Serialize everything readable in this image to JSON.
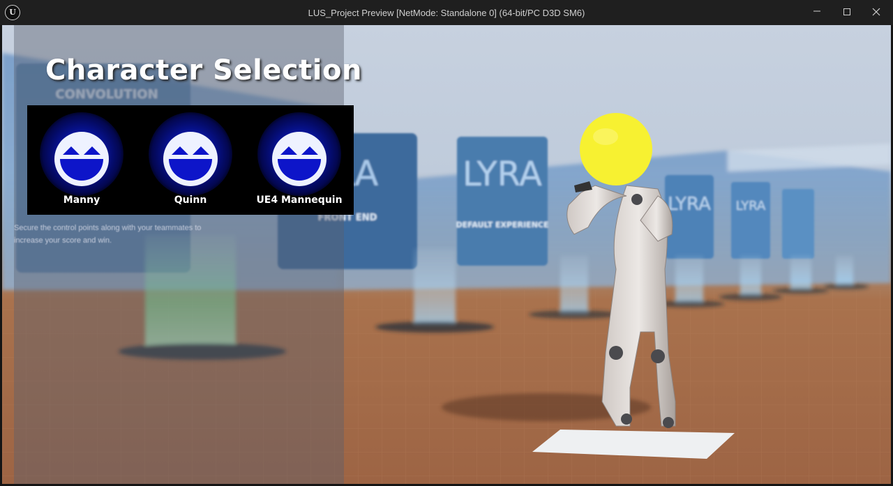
{
  "window": {
    "title": "LUS_Project Preview [NetMode: Standalone 0]  (64-bit/PC D3D SM6)",
    "logo_text": "U",
    "controls": [
      "minimize-icon",
      "maximize-icon",
      "close-icon"
    ]
  },
  "character_selection": {
    "title": "Character Selection",
    "characters": [
      {
        "name": "Manny",
        "icon": "smiley-face-icon"
      },
      {
        "name": "Quinn",
        "icon": "smiley-face-icon"
      },
      {
        "name": "UE4 Mannequin",
        "icon": "smiley-face-icon"
      }
    ],
    "icon_colors": {
      "face": "#eef2ff",
      "mouth": "#0d15c9",
      "glow": "#0a1bc4"
    }
  },
  "background_scene": {
    "sign_labels": [
      "CONVOLUTION",
      "LYRA",
      "LYRA",
      "FRONT END",
      "DEFAULT EXPERIENCE",
      "LYRA",
      "LYRA"
    ],
    "sign_text": "Secure the control points along with your teammates to increase your score and win."
  }
}
